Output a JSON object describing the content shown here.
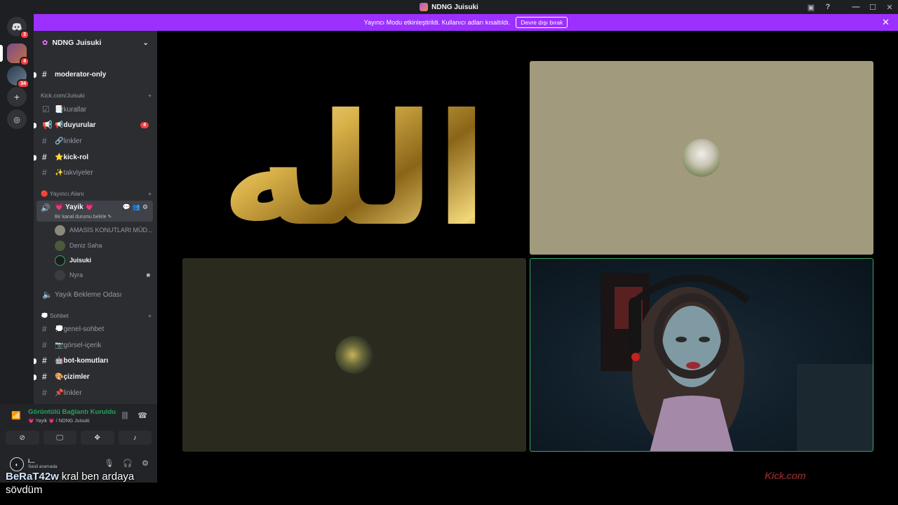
{
  "window": {
    "title": "NDNG Juisuki"
  },
  "banner": {
    "text": "Yayıncı Modu etkinleştirildi. Kullanıcı adları kısaltıldı.",
    "button": "Devre dışı bırak",
    "close": "✕"
  },
  "guilds": [
    {
      "name": "discord-home",
      "badge": "3"
    },
    {
      "name": "server-1",
      "badge": "4"
    },
    {
      "name": "server-2",
      "badge": "34"
    }
  ],
  "server": {
    "name": "NDNG Juisuki"
  },
  "channels": {
    "top": {
      "name": "moderator-only"
    },
    "cat1": {
      "label": "Kick.com/Juisuki"
    },
    "cat1_items": [
      {
        "icon": "📑",
        "name": "kurallar"
      },
      {
        "icon": "📢",
        "name": "duyurular",
        "badge": "4"
      },
      {
        "icon": "🔗",
        "name": "linkler"
      },
      {
        "icon": "⭐",
        "name": "kick-rol"
      },
      {
        "icon": "✨",
        "name": "takviyeler"
      }
    ],
    "cat2": {
      "label": "🔴 Yayıncı Alanı"
    },
    "voice": {
      "name": "💗 Yayik 💗",
      "status": "Bir kanal durumu belirle ✎"
    },
    "voice_users": [
      {
        "name": "AMASİS KONUTLARI MÜD..."
      },
      {
        "name": "Deniz Saha"
      },
      {
        "name": "Juisuki"
      },
      {
        "name": "Nyra"
      }
    ],
    "waiting": {
      "name": "Yayık Bekleme Odası"
    },
    "cat3": {
      "label": "💭 Sohbet"
    },
    "cat3_items": [
      {
        "icon": "💭",
        "name": "genel-sohbet"
      },
      {
        "icon": "📷",
        "name": "görsel-içerik"
      },
      {
        "icon": "🤖",
        "name": "bot-komutları"
      },
      {
        "icon": "🎨",
        "name": "çizimler"
      },
      {
        "icon": "📌",
        "name": "linkler"
      }
    ]
  },
  "rtc": {
    "title": "Görüntülü Bağlantı Kuruldu",
    "subtitle": "💗 Yayik 💗 / NDNG Juisuki"
  },
  "user": {
    "name": "i...",
    "status": "Sesli aramada"
  },
  "calligraphy": {
    "text": "الله"
  },
  "chat_overlay": {
    "username": "BeRaT42w",
    "message": "kral ben ardaya sövdüm"
  },
  "watermark": {
    "text": "Kick.com"
  },
  "colors": {
    "accent": "#9b30ff",
    "speaking": "#3ba55c",
    "tile_beige": "#a19a7d",
    "tile_olive": "#2b2a1f"
  }
}
